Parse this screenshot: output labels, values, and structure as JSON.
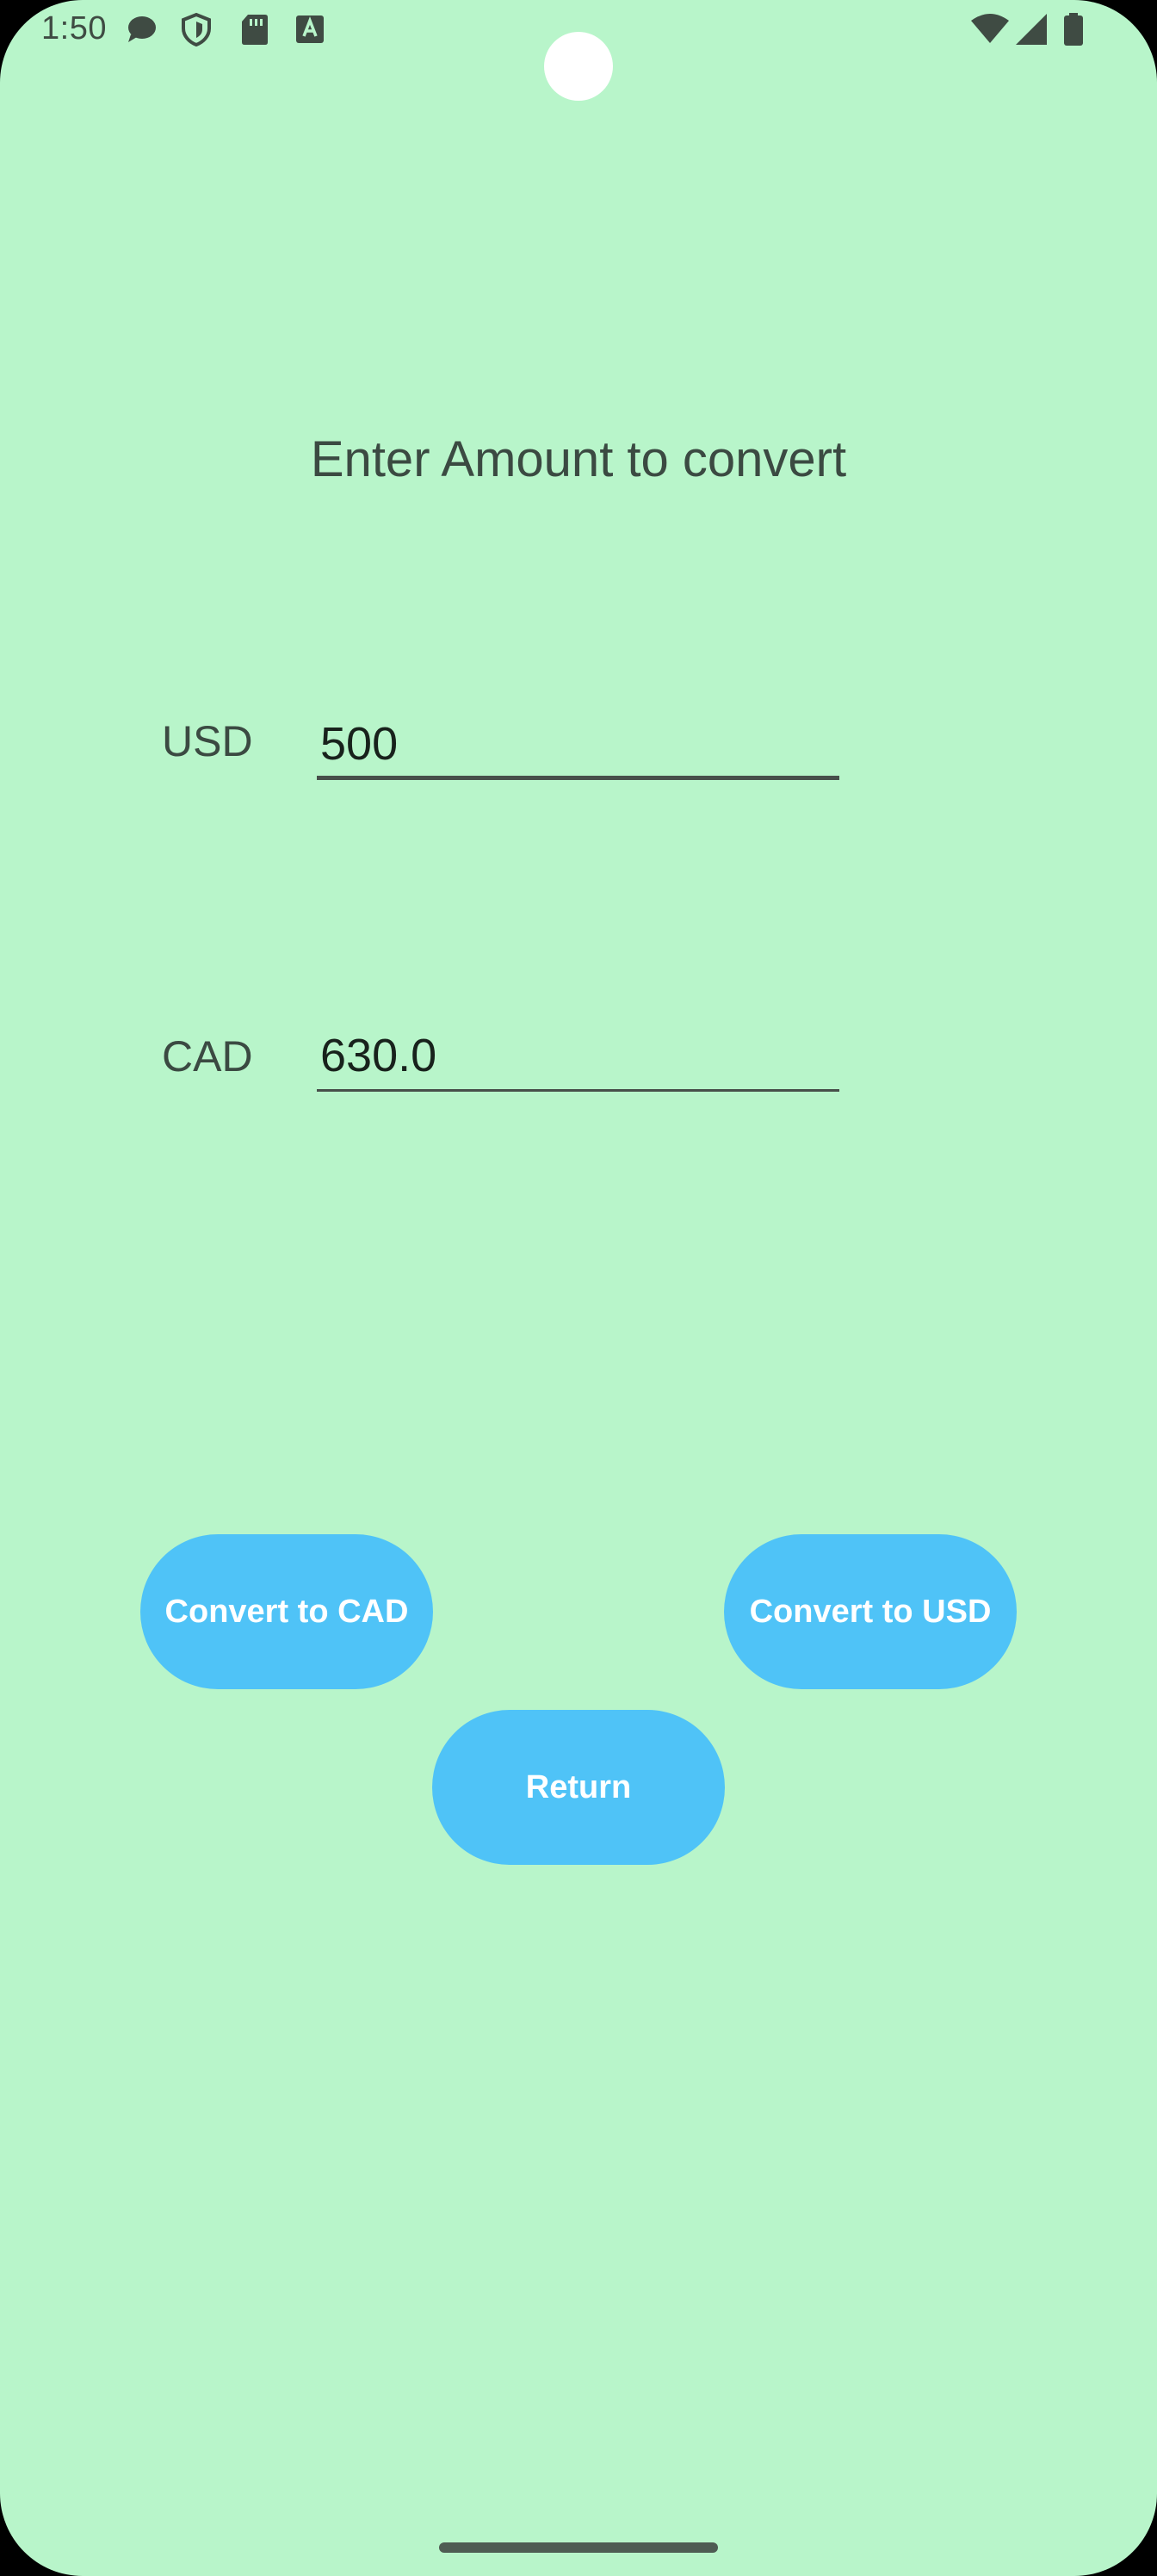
{
  "status_bar": {
    "time": "1:50",
    "left_icons": [
      "chat-bubble-icon",
      "shield-icon",
      "sd-card-icon",
      "keyboard-a-icon"
    ],
    "right_icons": [
      "wifi-icon",
      "cellular-signal-icon",
      "battery-icon"
    ]
  },
  "main": {
    "title": "Enter Amount to convert",
    "usd": {
      "label": "USD",
      "value": "500"
    },
    "cad": {
      "label": "CAD",
      "value": "630.0"
    },
    "buttons": {
      "convert_to_cad": "Convert to CAD",
      "convert_to_usd": "Convert to USD",
      "return": "Return"
    }
  },
  "colors": {
    "background": "#b8f5ca",
    "button": "#4fc3f7",
    "button_text": "#ffffff",
    "text": "#3b4a42"
  }
}
